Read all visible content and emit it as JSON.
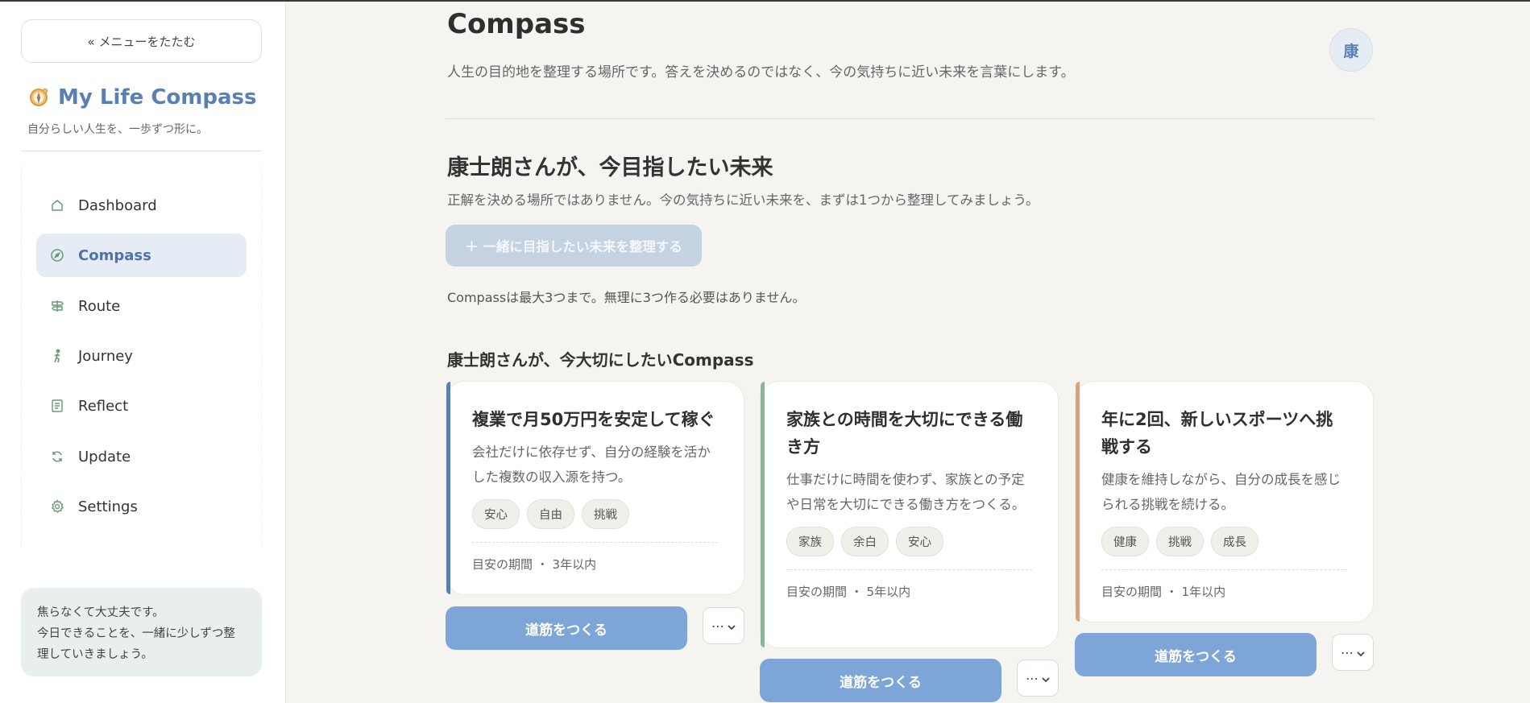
{
  "sidebar": {
    "collapse_label": "« メニューをたたむ",
    "brand_title": "My Life Compass",
    "brand_subtitle": "自分らしい人生を、一歩ずつ形に。",
    "items": [
      {
        "label": "Dashboard",
        "icon": "home-icon"
      },
      {
        "label": "Compass",
        "icon": "compass-icon",
        "active": true
      },
      {
        "label": "Route",
        "icon": "signpost-icon"
      },
      {
        "label": "Journey",
        "icon": "walking-icon"
      },
      {
        "label": "Reflect",
        "icon": "notes-icon"
      },
      {
        "label": "Update",
        "icon": "refresh-icon"
      },
      {
        "label": "Settings",
        "icon": "gear-icon"
      }
    ],
    "encouragement": [
      "焦らなくて大丈夫です。",
      "今日できることを、一緒に少しずつ整",
      "理していきましょう。"
    ]
  },
  "header": {
    "title": "Compass",
    "description": "人生の目的地を整理する場所です。答えを決めるのではなく、今の気持ちに近い未来を言葉にします。",
    "avatar_text": "康"
  },
  "future": {
    "heading": "康士朗さんが、今目指したい未来",
    "subtitle": "正解を決める場所ではありません。今の気持ちに近い未来を、まずは1つから整理してみましょう。",
    "add_button": "＋ 一緒に目指したい未来を整理する",
    "limit_note": "Compassは最大3つまで。無理に3つ作る必要はありません。"
  },
  "compass_section": {
    "heading": "康士朗さんが、今大切にしたいCompass",
    "cards": [
      {
        "title": "複業で月50万円を安定して稼ぐ",
        "description": "会社だけに依存せず、自分の経験を活かした複数の収入源を持つ。",
        "tags": [
          "安心",
          "自由",
          "挑戦"
        ],
        "period": "目安の期間 ・ 3年以内",
        "accent_color": "#5a7fb5",
        "road_button": "道筋をつくる",
        "more_label": "⋯"
      },
      {
        "title": "家族との時間を大切にできる働き方",
        "description": "仕事だけに時間を使わず、家族との予定や日常を大切にできる働き方をつくる。",
        "tags": [
          "家族",
          "余白",
          "安心"
        ],
        "period": "目安の期間 ・ 5年以内",
        "accent_color": "#8fb39a",
        "road_button": "道筋をつくる",
        "more_label": "⋯"
      },
      {
        "title": "年に2回、新しいスポーツへ挑戦する",
        "description": "健康を維持しながら、自分の成長を感じられる挑戦を続ける。",
        "tags": [
          "健康",
          "挑戦",
          "成長"
        ],
        "period": "目安の期間 ・ 1年以内",
        "accent_color": "#e0a070",
        "road_button": "道筋をつくる",
        "more_label": "⋯"
      }
    ]
  }
}
